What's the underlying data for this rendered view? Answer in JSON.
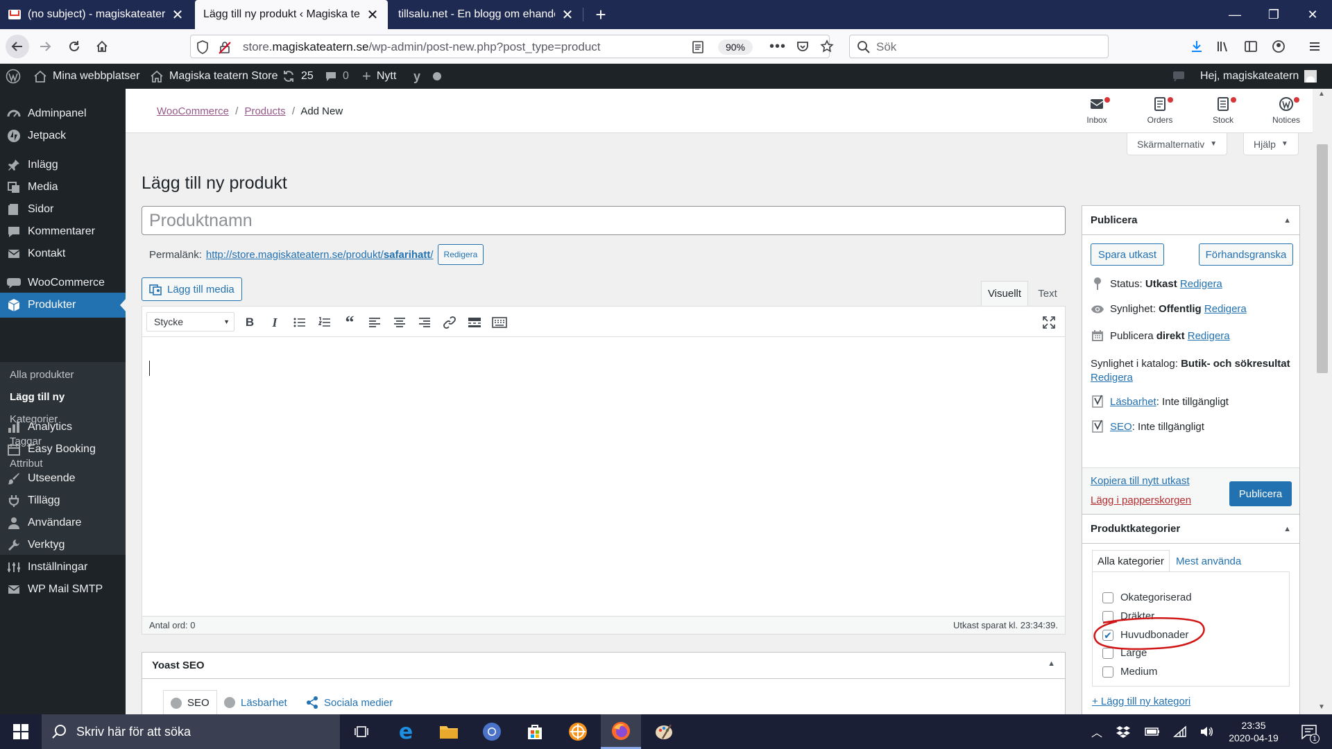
{
  "browser": {
    "tabs": [
      {
        "title": "(no subject) - magiskateatern.se",
        "active": false
      },
      {
        "title": "Lägg till ny produkt ‹ Magiska teatern Store",
        "active": true
      },
      {
        "title": "tillsalu.net - En blogg om ehandel.",
        "active": false
      }
    ],
    "url": {
      "prefix": "store.",
      "domain": "magiskateatern.se",
      "path": "/wp-admin/post-new.php?post_type=product"
    },
    "zoom": "90%",
    "search_placeholder": "Sök"
  },
  "adminbar": {
    "my_sites": "Mina webbplatser",
    "site_name": "Magiska teatern Store",
    "updates": "25",
    "comments": "0",
    "new": "Nytt",
    "howdy": "Hej, magiskateatern"
  },
  "sidebar": {
    "items": [
      {
        "label": "Adminpanel",
        "icon": "dashboard-icon"
      },
      {
        "label": "Jetpack",
        "icon": "jetpack-icon"
      },
      {
        "label": "Inlägg",
        "icon": "pin-icon"
      },
      {
        "label": "Media",
        "icon": "media-icon"
      },
      {
        "label": "Sidor",
        "icon": "page-icon"
      },
      {
        "label": "Kommentarer",
        "icon": "comment-icon"
      },
      {
        "label": "Kontakt",
        "icon": "mail-icon"
      },
      {
        "label": "WooCommerce",
        "icon": "woocommerce-icon"
      },
      {
        "label": "Produkter",
        "icon": "products-icon"
      },
      {
        "label": "Analytics",
        "icon": "bar-chart-icon"
      },
      {
        "label": "Easy Booking",
        "icon": "calendar-icon"
      },
      {
        "label": "Utseende",
        "icon": "brush-icon"
      },
      {
        "label": "Tillägg",
        "icon": "plugin-icon"
      },
      {
        "label": "Användare",
        "icon": "user-icon"
      },
      {
        "label": "Verktyg",
        "icon": "wrench-icon"
      },
      {
        "label": "Inställningar",
        "icon": "settings-icon"
      },
      {
        "label": "WP Mail SMTP",
        "icon": "mail-icon"
      }
    ],
    "submenu": [
      "Alla produkter",
      "Lägg till ny",
      "Kategorier",
      "Taggar",
      "Attribut"
    ]
  },
  "wc_header": {
    "breadcrumb": [
      "WooCommerce",
      "Products",
      "Add New"
    ],
    "activity": [
      "Inbox",
      "Orders",
      "Stock",
      "Notices"
    ]
  },
  "screen_options": "Skärmalternativ",
  "help": "Hjälp",
  "page_title": "Lägg till ny produkt",
  "title_placeholder": "Produktnamn",
  "permalink": {
    "label": "Permalänk:",
    "url_base": "http://store.magiskateatern.se/produkt/",
    "slug": "safarihatt",
    "url_end": "/",
    "edit": "Redigera"
  },
  "editor": {
    "add_media": "Lägg till media",
    "tab_visual": "Visuellt",
    "tab_text": "Text",
    "format": "Stycke",
    "word_count": "Antal ord: 0",
    "draft_saved": "Utkast sparat kl. 23:34:39."
  },
  "yoast": {
    "title": "Yoast SEO",
    "tabs": [
      "SEO",
      "Läsbarhet",
      "Sociala medier"
    ]
  },
  "publish": {
    "title": "Publicera",
    "save_draft": "Spara utkast",
    "preview": "Förhandsgranska",
    "status_label": "Status:",
    "status_value": "Utkast",
    "visibility_label": "Synlighet:",
    "visibility_value": "Offentlig",
    "publish_label": "Publicera",
    "publish_value": "direkt",
    "catalog_label": "Synlighet i katalog:",
    "catalog_value": "Butik- och sökresultat",
    "edit": "Redigera",
    "readability_link": "Läsbarhet",
    "readability_value": ": Inte tillgängligt",
    "seo_link": "SEO",
    "seo_value": ": Inte tillgängligt",
    "copy_draft": "Kopiera till nytt utkast",
    "trash": "Lägg i papperskorgen",
    "publish_button": "Publicera"
  },
  "categories": {
    "title": "Produktkategorier",
    "tab_all": "Alla kategorier",
    "tab_most": "Mest använda",
    "items": [
      {
        "label": "Okategoriserad",
        "checked": false
      },
      {
        "label": "Dräkter",
        "checked": false
      },
      {
        "label": "Huvudbonader",
        "checked": true
      },
      {
        "label": "Large",
        "checked": false
      },
      {
        "label": "Medium",
        "checked": false
      }
    ],
    "add_new": "+ Lägg till ny kategori"
  },
  "taskbar": {
    "search_placeholder": "Skriv här för att söka",
    "time": "23:35",
    "date": "2020-04-19",
    "notif_count": "1"
  },
  "colors": {
    "wp_blue": "#2271b1",
    "admin_dark": "#1d2327",
    "woo_purple": "#96588a",
    "annotation_red": "#d01616"
  }
}
